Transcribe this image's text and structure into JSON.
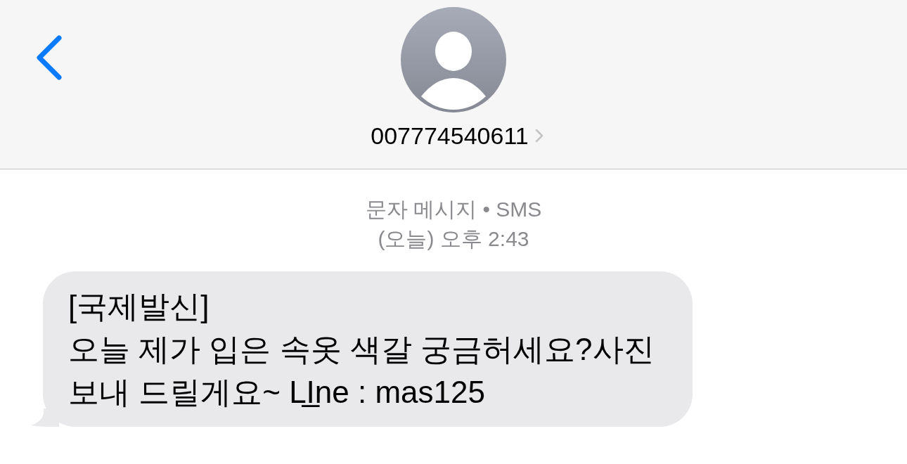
{
  "header": {
    "contact": {
      "name": "007774540611"
    }
  },
  "conversation": {
    "service_label": "문자 메시지 • SMS",
    "timestamp": "(오늘) 오후 2:43",
    "messages": [
      {
        "kind": "incoming",
        "text": "[국제발신]\n오늘 제가 입은 속옷 색갈 궁금허세요?사진\n보내 드릴게요~ LI̲ne : mas125"
      }
    ]
  }
}
